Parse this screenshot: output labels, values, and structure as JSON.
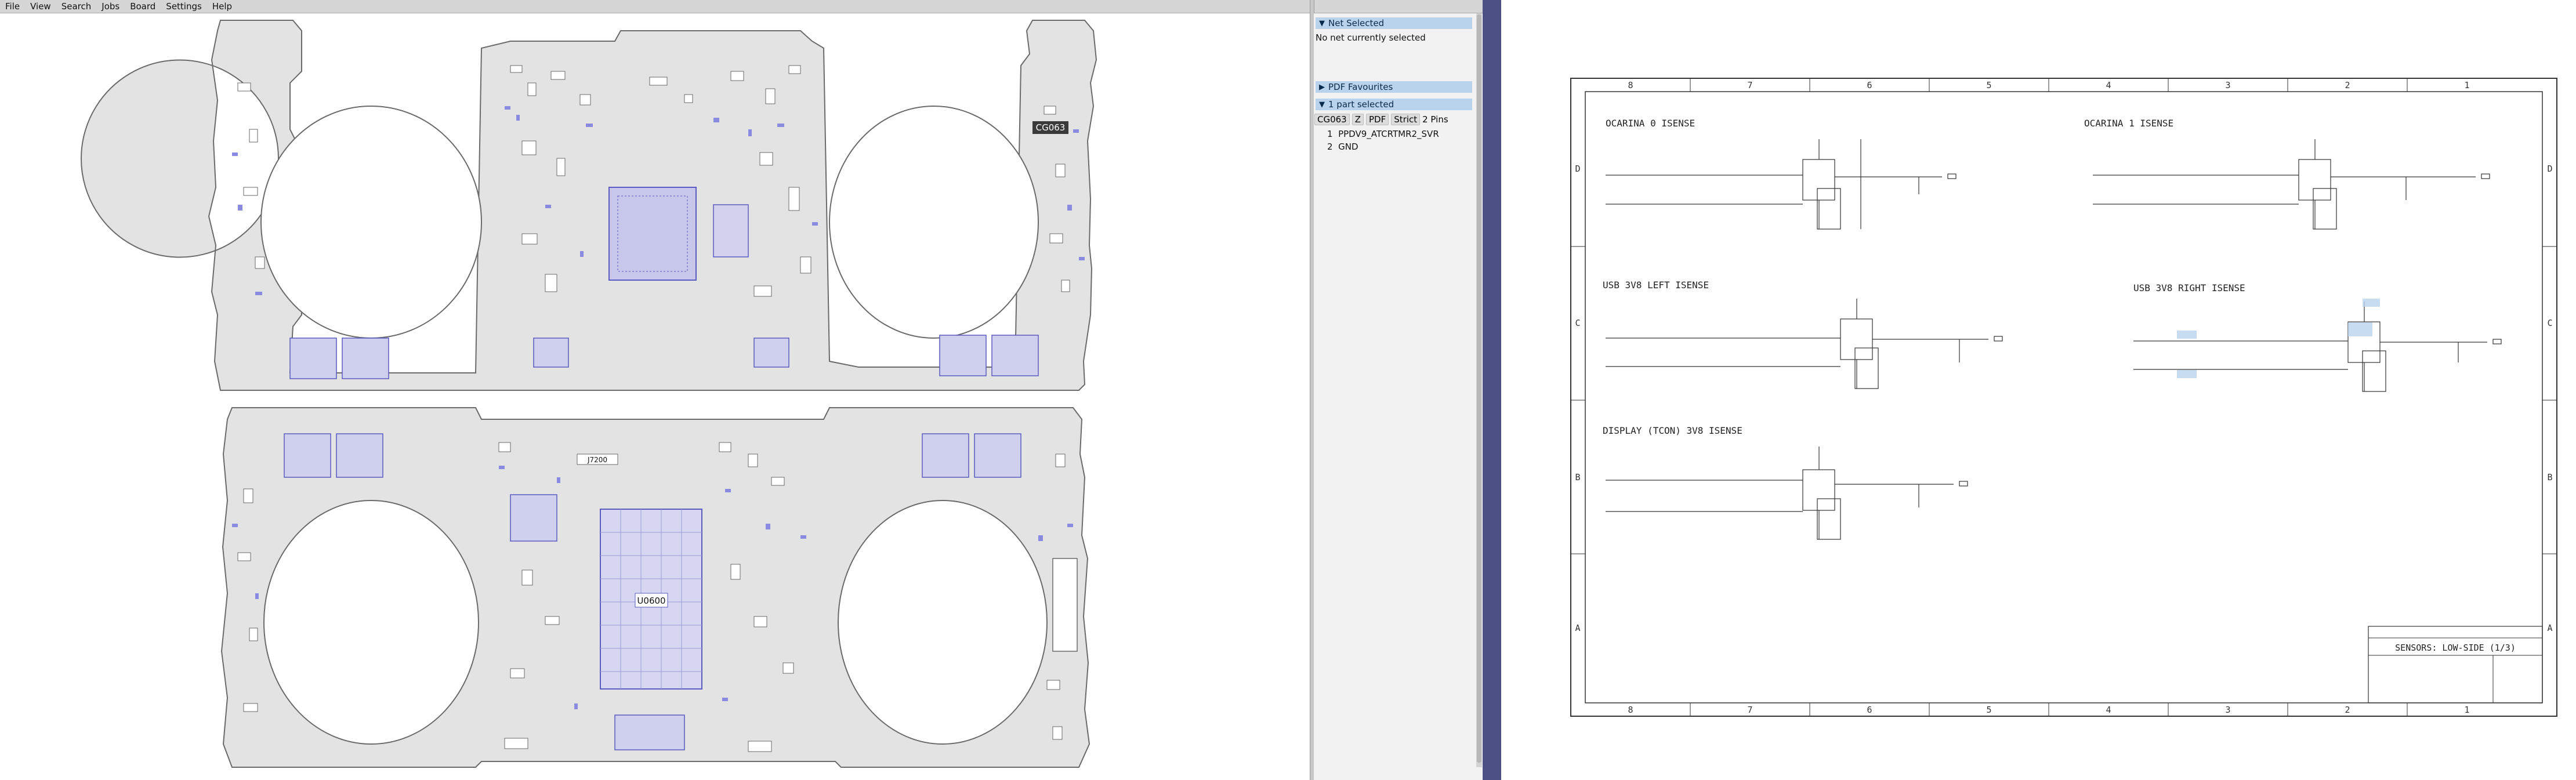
{
  "menu": [
    "File",
    "View",
    "Search",
    "Jobs",
    "Board",
    "Settings",
    "Help"
  ],
  "board": {
    "labels": {
      "cg063": "CG063",
      "j7200": "J7200",
      "u0600": "U0600"
    }
  },
  "side": {
    "net_header": "Net Selected",
    "net_empty": "No net currently selected",
    "pdf_header": "PDF Favourites",
    "parts_header": "1 part selected",
    "part_name": "CG063",
    "btn_z": "Z",
    "btn_pdf": "PDF",
    "btn_strict": "Strict",
    "pins_count": "2 Pins",
    "pins": [
      {
        "num": "1",
        "net": "PPDV9_ATCRTMR2_SVR"
      },
      {
        "num": "2",
        "net": "GND"
      }
    ]
  },
  "schematic": {
    "columns": [
      "8",
      "7",
      "6",
      "5",
      "4",
      "3",
      "2",
      "1"
    ],
    "rows": [
      "D",
      "C",
      "B",
      "A"
    ],
    "blocks": [
      {
        "title": "OCARINA 0 ISENSE"
      },
      {
        "title": "OCARINA 1 ISENSE"
      },
      {
        "title": "USB 3V8 LEFT ISENSE"
      },
      {
        "title": "USB 3V8 RIGHT ISENSE"
      },
      {
        "title": "DISPLAY (TCON) 3V8 ISENSE"
      }
    ],
    "title_block": "SENSORS: LOW-SIDE (1/3)"
  },
  "colors": {
    "board_fill": "#e3e3e3",
    "board_outline": "#6a6a6a",
    "component": "#7878d8",
    "highlight": "#b9d3ec",
    "divider": "#4c5084"
  }
}
